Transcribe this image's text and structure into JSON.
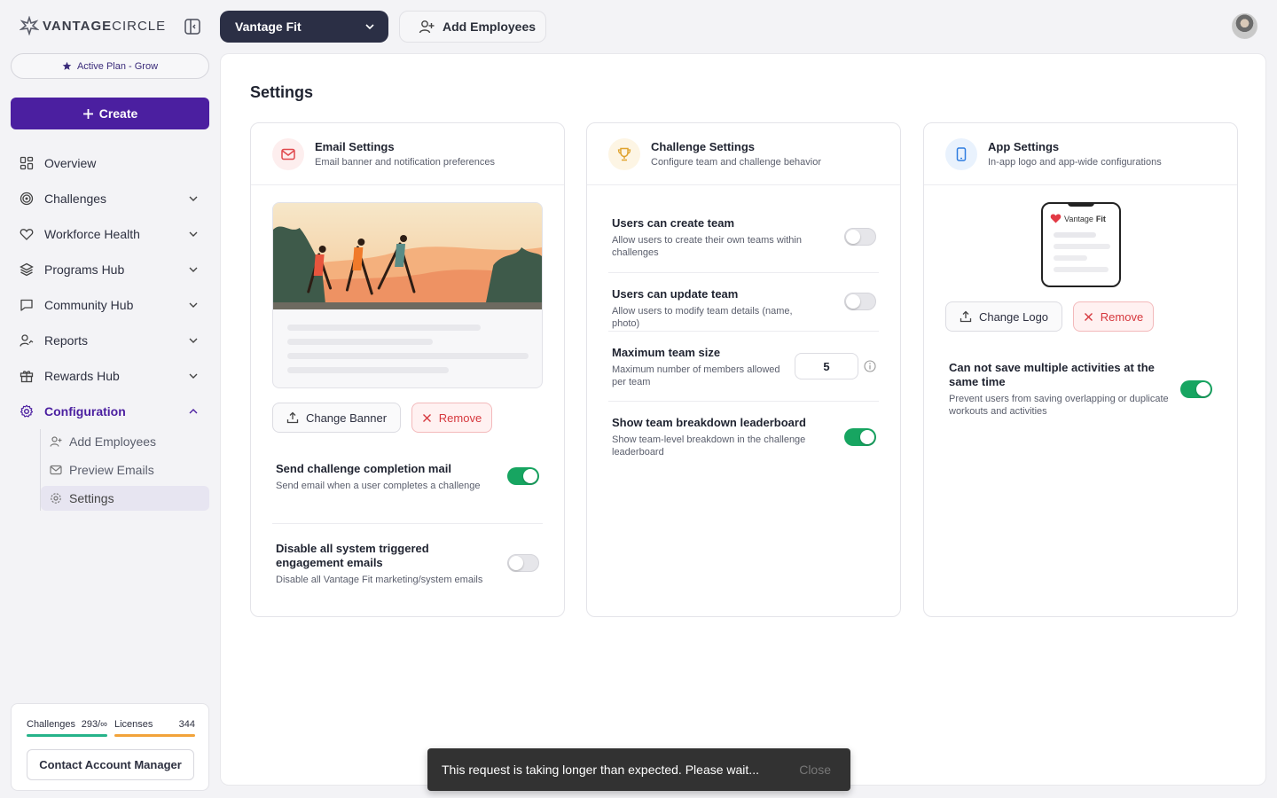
{
  "header": {
    "logo_bold": "VANTAGE",
    "logo_light": "CIRCLE",
    "workspace": "Vantage Fit",
    "add_employees": "Add Employees"
  },
  "sidebar": {
    "plan": "Active Plan - Grow",
    "create": "Create",
    "items": [
      {
        "label": "Overview",
        "icon": "grid-icon"
      },
      {
        "label": "Challenges",
        "icon": "target-icon"
      },
      {
        "label": "Workforce Health",
        "icon": "heart-icon"
      },
      {
        "label": "Programs Hub",
        "icon": "layers-icon"
      },
      {
        "label": "Community Hub",
        "icon": "chat-icon"
      },
      {
        "label": "Reports",
        "icon": "user-chart-icon"
      },
      {
        "label": "Rewards Hub",
        "icon": "gift-icon"
      },
      {
        "label": "Configuration",
        "icon": "gear-icon"
      }
    ],
    "sub_items": [
      {
        "label": "Add Employees",
        "icon": "add-user-icon"
      },
      {
        "label": "Preview Emails",
        "icon": "mail-icon"
      },
      {
        "label": "Settings",
        "icon": "gear-icon"
      }
    ],
    "usage": {
      "challenges_label": "Challenges",
      "challenges_value": "293/∞",
      "licenses_label": "Licenses",
      "licenses_value": "344",
      "challenges_color": "#26b38a",
      "licenses_color": "#f2a33a"
    },
    "contact": "Contact Account Manager"
  },
  "main": {
    "title": "Settings",
    "email": {
      "title": "Email Settings",
      "subtitle": "Email banner and notification preferences",
      "change_banner": "Change Banner",
      "remove": "Remove",
      "s1_title": "Send challenge completion mail",
      "s1_desc": "Send email when a user completes a challenge",
      "s1_on": true,
      "s2_title": "Disable all system triggered engagement emails",
      "s2_desc": "Disable all Vantage Fit marketing/system emails",
      "s2_on": false
    },
    "challenge": {
      "title": "Challenge Settings",
      "subtitle": "Configure team and challenge behavior",
      "s1_title": "Users can create team",
      "s1_desc": "Allow users to create their own teams within challenges",
      "s1_on": false,
      "s2_title": "Users can update team",
      "s2_desc": "Allow users to modify team details (name, photo)",
      "s2_on": false,
      "s3_title": "Maximum team size",
      "s3_desc": "Maximum number of members allowed per team",
      "s3_value": "5",
      "s4_title": "Show team breakdown leaderboard",
      "s4_desc": "Show team-level breakdown in the challenge leaderboard",
      "s4_on": true
    },
    "app": {
      "title": "App Settings",
      "subtitle": "In-app logo and app-wide configurations",
      "phone_brand": "Vantage",
      "phone_brand_bold": "Fit",
      "change_logo": "Change Logo",
      "remove": "Remove",
      "s1_title": "Can not save multiple activities at the same time",
      "s1_desc": "Prevent users from saving overlapping or duplicate workouts and activities",
      "s1_on": true
    }
  },
  "toast": {
    "message": "This request is taking longer than expected. Please wait...",
    "close": "Close"
  }
}
